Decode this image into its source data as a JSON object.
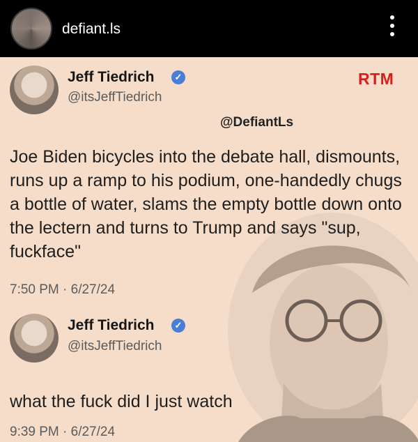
{
  "story": {
    "username": "defiant.ls"
  },
  "tweet": {
    "author_name": "Jeff Tiedrich",
    "author_handle": "@itsJeffTiedrich",
    "badge": "RTM",
    "watermark": "@DefiantLs",
    "text": "Joe Biden bicycles into the debate hall, dismounts, runs up a ramp to his podium, one-handedly chugs a bottle of water, slams the empty bottle down onto the lectern and turns to Trump and says \"sup, fuckface\"",
    "timestamp": "7:50 PM · 6/27/24"
  },
  "reply": {
    "author_name": "Jeff Tiedrich",
    "author_handle": "@itsJeffTiedrich",
    "text": "what the fuck did I just watch",
    "timestamp": "9:39 PM · 6/27/24"
  },
  "colors": {
    "background": "#f6ddc9",
    "topbar": "#000000",
    "rtm": "#d51f1f",
    "verified": "#4a7dd6"
  },
  "icons": {
    "verified": "verified-badge-icon",
    "menu": "more-vertical-icon"
  }
}
